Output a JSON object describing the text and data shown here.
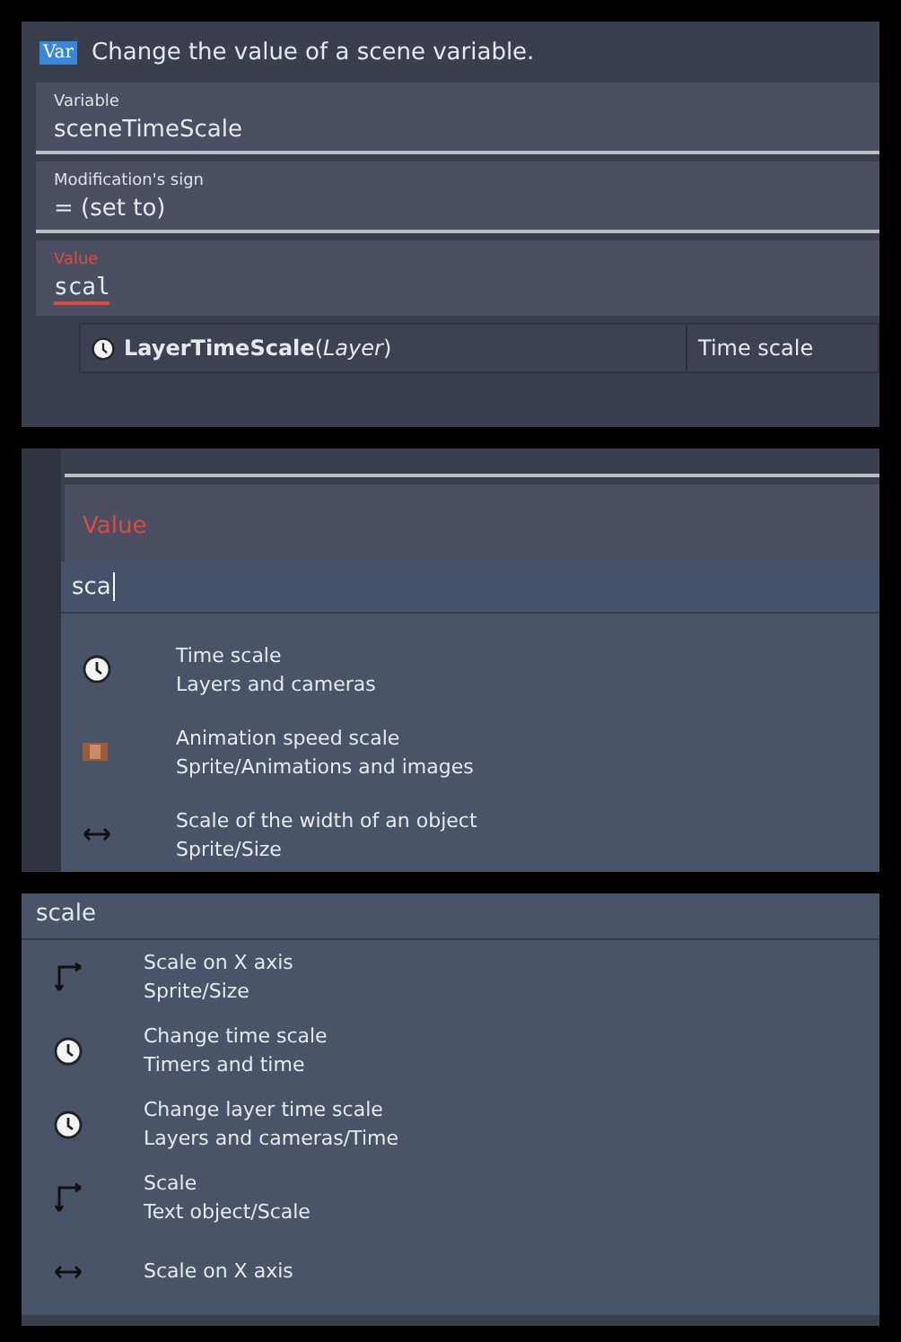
{
  "action_editor": {
    "badge": "Var",
    "title": "Change the value of a scene variable.",
    "fields": [
      {
        "label": "Variable",
        "value": "sceneTimeScale",
        "invalid": false,
        "kind": "text"
      },
      {
        "label": "Modification's sign",
        "value": "= (set to)",
        "invalid": false,
        "kind": "text"
      },
      {
        "label": "Value",
        "value": "scal",
        "invalid": true,
        "kind": "expression"
      }
    ],
    "suggestion": {
      "kind": "clock",
      "name": "**LayerTimeScale**(*Layer*)",
      "description": "Time scale"
    }
  },
  "value_picker": {
    "label": "Value",
    "invalid": true,
    "input": "sca",
    "items": [
      {
        "kind": "clock",
        "title": "Time scale",
        "category": "Layers and cameras"
      },
      {
        "kind": "film",
        "title": "Animation speed scale",
        "category": "Sprite/Animations and images"
      },
      {
        "kind": "width",
        "title": "Scale of the width of an object",
        "category": "Sprite/Size"
      }
    ]
  },
  "expression_search": {
    "query": "scale",
    "items": [
      {
        "kind": "corner",
        "title": "Scale on X axis",
        "category": "Sprite/Size"
      },
      {
        "kind": "clock",
        "title": "Change time scale",
        "category": "Timers and time"
      },
      {
        "kind": "clock",
        "title": "Change layer time scale",
        "category": "Layers and cameras/Time"
      },
      {
        "kind": "corner",
        "title": "Scale",
        "category": "Text object/Scale"
      },
      {
        "kind": "width",
        "title": "Scale on X axis"
      }
    ]
  }
}
